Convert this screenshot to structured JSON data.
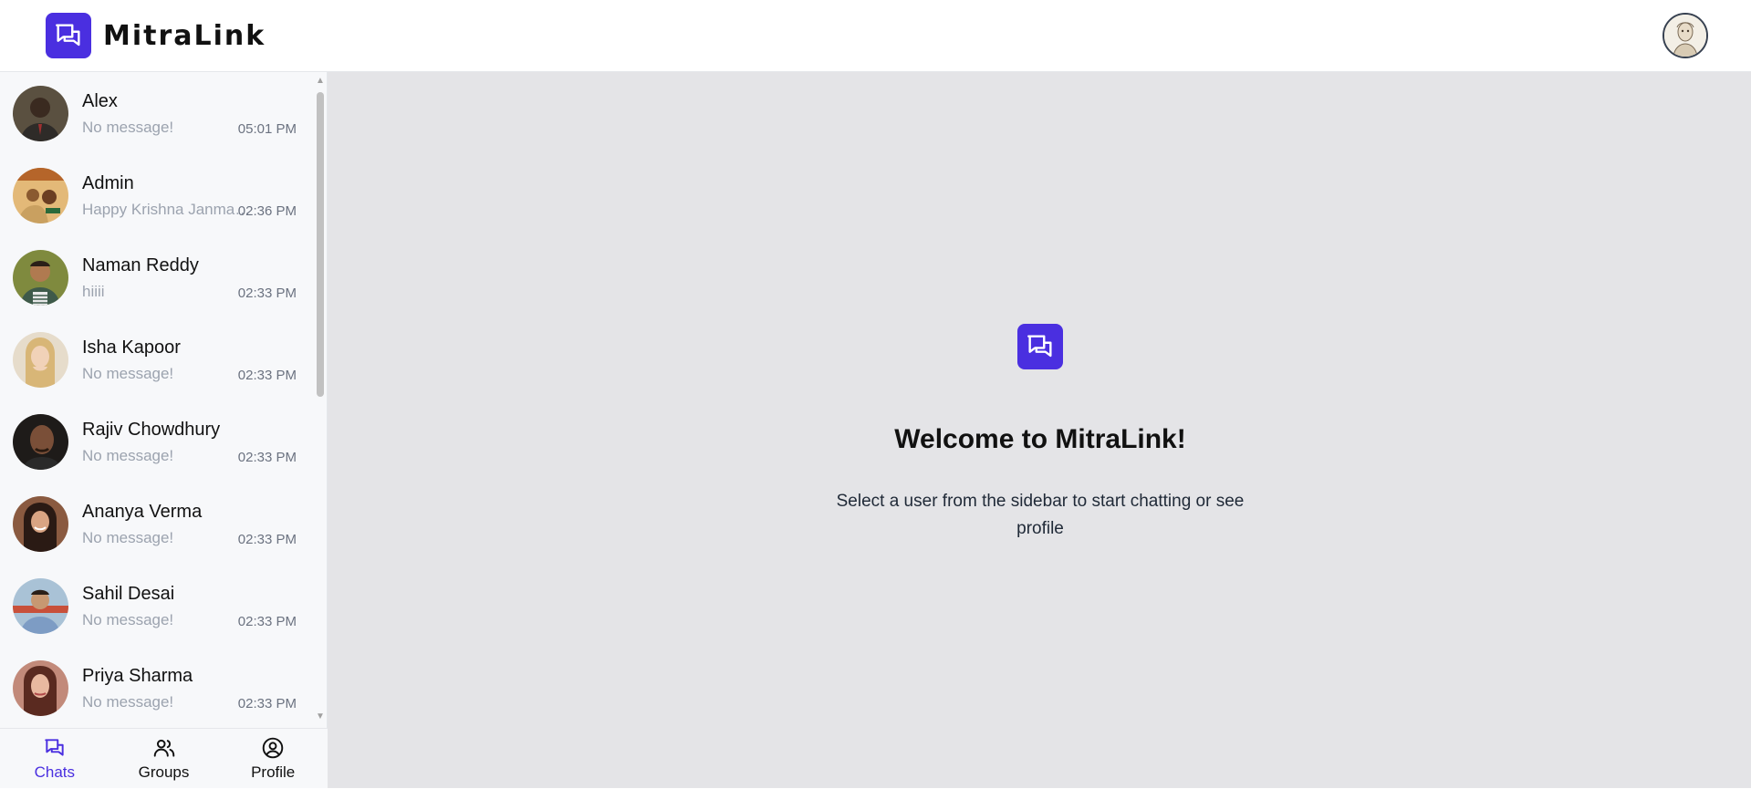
{
  "app": {
    "name": "MitraLink",
    "accent": "#4a2fe0"
  },
  "header": {
    "logo_icon": "chat-bubbles-icon",
    "avatar": "user-avatar"
  },
  "chats": [
    {
      "name": "Alex",
      "message": "No message!",
      "time": "05:01 PM",
      "avatar_color": "#4b3b2a"
    },
    {
      "name": "Admin",
      "message": "Happy Krishna Janmashtami",
      "time": "02:36 PM",
      "avatar_color": "#c98b4a"
    },
    {
      "name": "Naman Reddy",
      "message": "hiiii",
      "time": "02:33 PM",
      "avatar_color": "#6b7d3a"
    },
    {
      "name": "Isha Kapoor",
      "message": "No message!",
      "time": "02:33 PM",
      "avatar_color": "#d9c3a5"
    },
    {
      "name": "Rajiv Chowdhury",
      "message": "No message!",
      "time": "02:33 PM",
      "avatar_color": "#2b2623"
    },
    {
      "name": "Ananya Verma",
      "message": "No message!",
      "time": "02:33 PM",
      "avatar_color": "#7a4e3b"
    },
    {
      "name": "Sahil Desai",
      "message": "No message!",
      "time": "02:33 PM",
      "avatar_color": "#9fb4c8"
    },
    {
      "name": "Priya Sharma",
      "message": "No message!",
      "time": "02:33 PM",
      "avatar_color": "#8a4a3e"
    }
  ],
  "nav": {
    "chats": "Chats",
    "groups": "Groups",
    "profile": "Profile"
  },
  "welcome": {
    "title": "Welcome to MitraLink!",
    "subtitle": "Select a user from the sidebar to start chatting or see profile"
  }
}
